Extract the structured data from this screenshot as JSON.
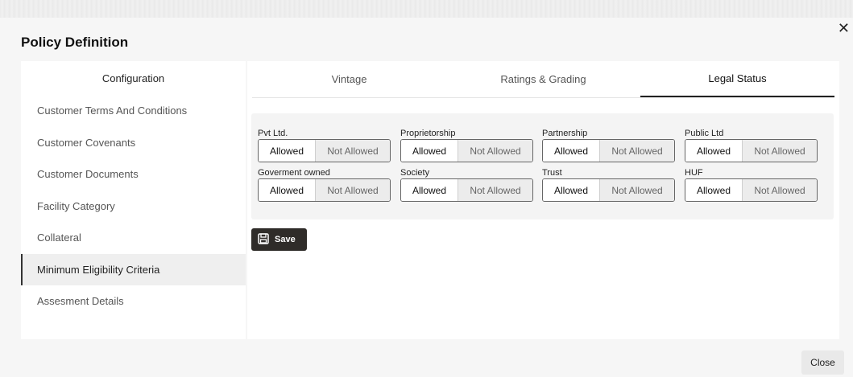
{
  "dialog": {
    "title": "Policy Definition",
    "close_icon": "close-icon"
  },
  "sidebar": {
    "header": "Configuration",
    "items": [
      {
        "label": "Customer Terms And Conditions"
      },
      {
        "label": "Customer Covenants"
      },
      {
        "label": "Customer Documents"
      },
      {
        "label": "Facility Category"
      },
      {
        "label": "Collateral"
      },
      {
        "label": "Minimum Eligibility Criteria",
        "active": true
      },
      {
        "label": "Assesment Details"
      }
    ]
  },
  "tabs": [
    {
      "label": "Vintage"
    },
    {
      "label": "Ratings & Grading"
    },
    {
      "label": "Legal Status",
      "active": true
    }
  ],
  "legal_status": {
    "fields": [
      {
        "label": "Pvt Ltd.",
        "allowed": "Allowed",
        "not_allowed": "Not Allowed",
        "value": "Allowed"
      },
      {
        "label": "Proprietorship",
        "allowed": "Allowed",
        "not_allowed": "Not Allowed",
        "value": "Allowed"
      },
      {
        "label": "Partnership",
        "allowed": "Allowed",
        "not_allowed": "Not Allowed",
        "value": "Allowed"
      },
      {
        "label": "Public Ltd",
        "allowed": "Allowed",
        "not_allowed": "Not Allowed",
        "value": "Allowed"
      },
      {
        "label": "Goverment owned",
        "allowed": "Allowed",
        "not_allowed": "Not Allowed",
        "value": "Allowed"
      },
      {
        "label": "Society",
        "allowed": "Allowed",
        "not_allowed": "Not Allowed",
        "value": "Allowed"
      },
      {
        "label": "Trust",
        "allowed": "Allowed",
        "not_allowed": "Not Allowed",
        "value": "Allowed"
      },
      {
        "label": "HUF",
        "allowed": "Allowed",
        "not_allowed": "Not Allowed",
        "value": "Allowed"
      }
    ]
  },
  "actions": {
    "save_label": "Save",
    "save_icon": "save-icon",
    "close_label": "Close"
  }
}
